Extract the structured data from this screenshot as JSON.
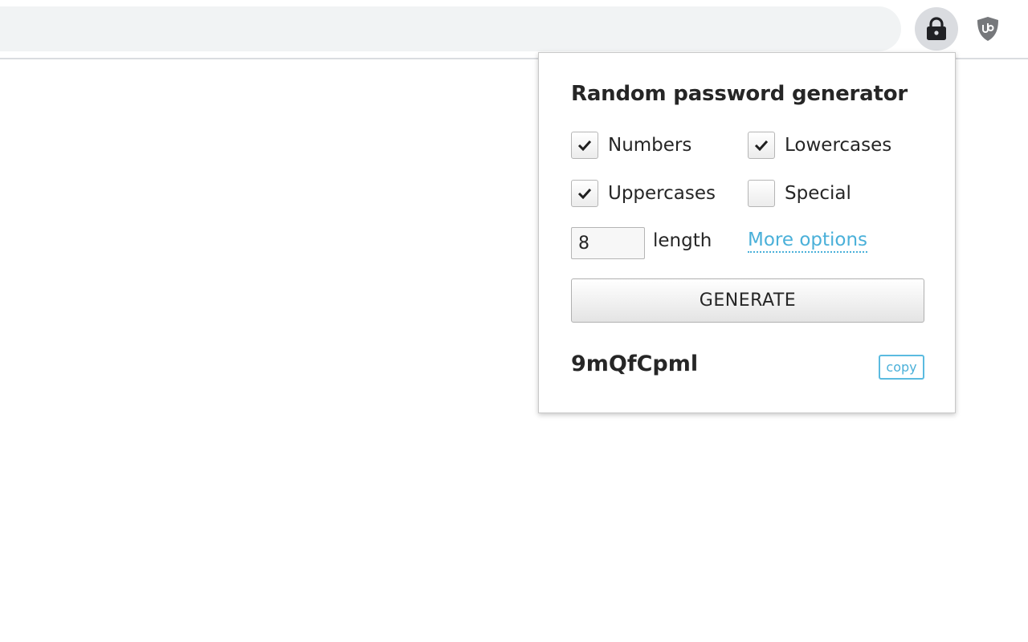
{
  "browser": {
    "extensions": [
      {
        "icon": "lock-icon",
        "active": true
      },
      {
        "icon": "ublock-shield-icon",
        "active": false
      }
    ]
  },
  "popup": {
    "title": "Random password generator",
    "options": {
      "numbers": {
        "label": "Numbers",
        "checked": true
      },
      "lowercases": {
        "label": "Lowercases",
        "checked": true
      },
      "uppercases": {
        "label": "Uppercases",
        "checked": true
      },
      "special": {
        "label": "Special",
        "checked": false
      }
    },
    "length": {
      "value": "8",
      "label": "length"
    },
    "more_options_label": "More options",
    "generate_label": "GENERATE",
    "password": "9mQfCpml",
    "copy_label": "copy"
  },
  "colors": {
    "accent": "#4ab0d9",
    "text": "#262626"
  }
}
